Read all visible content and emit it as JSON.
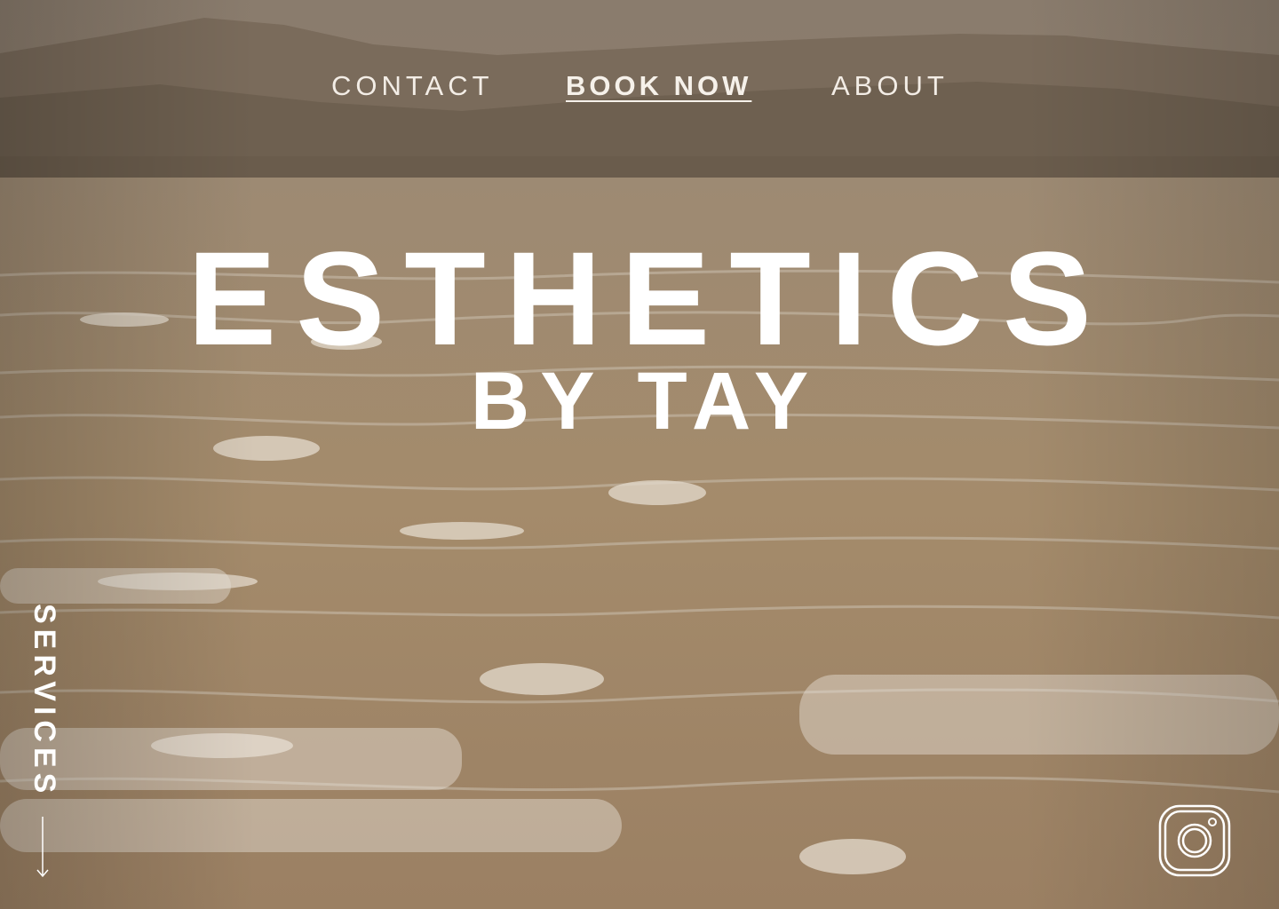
{
  "nav": {
    "contact": "CONTACT",
    "book_now": "BOOK NOW",
    "about": "ABOUT"
  },
  "hero": {
    "title": "ESTHETICS",
    "subtitle": "BY TAY"
  },
  "side": {
    "services_label": "SERVICES",
    "arrow_icon": "arrow-down-icon"
  },
  "social": {
    "icon": "instagram-icon"
  },
  "colors": {
    "text": "#ffffff",
    "nav_text": "#f3ede6",
    "sky": "#8d7d6c",
    "mountains": "#6f6252",
    "sea": "#a38b6c",
    "foam": "#e6ddd0"
  }
}
